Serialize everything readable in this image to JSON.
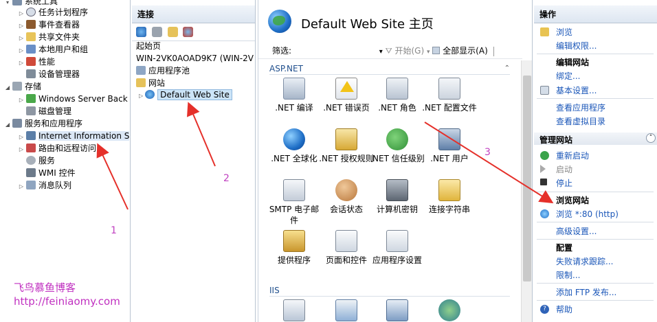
{
  "left_tree": {
    "items": [
      {
        "label": "系统工具",
        "icon": "tools-icon",
        "expand": "▾"
      },
      {
        "label": "任务计划程序",
        "icon": "clock-icon",
        "expand": "▷"
      },
      {
        "label": "事件查看器",
        "icon": "event-log-icon",
        "expand": "▷"
      },
      {
        "label": "共享文件夹",
        "icon": "shared-folder-icon",
        "expand": "▷"
      },
      {
        "label": "本地用户和组",
        "icon": "users-icon",
        "expand": "▷"
      },
      {
        "label": "性能",
        "icon": "performance-icon",
        "expand": "▷"
      },
      {
        "label": "设备管理器",
        "icon": "device-manager-icon",
        "expand": ""
      },
      {
        "label": "存储",
        "icon": "storage-icon",
        "expand": "◢"
      },
      {
        "label": "Windows Server Back",
        "icon": "backup-icon",
        "expand": "▷"
      },
      {
        "label": "磁盘管理",
        "icon": "disk-icon",
        "expand": ""
      },
      {
        "label": "服务和应用程序",
        "icon": "services-apps-icon",
        "expand": "◢"
      },
      {
        "label": "Internet Information S",
        "icon": "iis-icon",
        "expand": "▷"
      },
      {
        "label": "路由和远程访问",
        "icon": "routing-icon",
        "expand": "▷"
      },
      {
        "label": "服务",
        "icon": "gear-icon",
        "expand": ""
      },
      {
        "label": "WMI 控件",
        "icon": "wmi-icon",
        "expand": ""
      },
      {
        "label": "消息队列",
        "icon": "queue-icon",
        "expand": "▷"
      }
    ]
  },
  "connections": {
    "header": "连接",
    "items": [
      {
        "label": "起始页",
        "indent": 0,
        "icon": ""
      },
      {
        "label": "WIN-2VK0AOAD9K7 (WIN-2V",
        "indent": 0,
        "icon": ""
      },
      {
        "label": "应用程序池",
        "indent": 0,
        "icon": "app-pool-icon"
      },
      {
        "label": "网站",
        "indent": 0,
        "icon": "sites-folder-icon"
      },
      {
        "label": "Default Web Site",
        "indent": 1,
        "icon": "website-globe-icon",
        "expand": "▷"
      }
    ]
  },
  "main": {
    "title": "Default Web Site 主页",
    "filter": {
      "label": "筛选:",
      "dropdown": "▾",
      "start": "开始(G)",
      "show_all": "全部显示(A)"
    },
    "groups": [
      {
        "name": "ASP.NET",
        "features": [
          {
            "label": ".NET 编译",
            "icon": "net-compile-icon"
          },
          {
            "label": ".NET 错误页",
            "icon": "net-error-pages-icon"
          },
          {
            "label": ".NET 角色",
            "icon": "net-roles-icon"
          },
          {
            "label": ".NET 配置文件",
            "icon": "net-profile-icon"
          },
          {
            "label": ".NET 全球化",
            "icon": "net-globalization-icon"
          },
          {
            "label": ".NET 授权规则",
            "icon": "net-authorization-icon"
          },
          {
            "label": ".NET 信任级别",
            "icon": "net-trust-levels-icon"
          },
          {
            "label": ".NET 用户",
            "icon": "net-users-icon"
          },
          {
            "label": "SMTP 电子邮件",
            "icon": "smtp-email-icon"
          },
          {
            "label": "会话状态",
            "icon": "session-state-icon"
          },
          {
            "label": "计算机密钥",
            "icon": "machine-key-icon"
          },
          {
            "label": "连接字符串",
            "icon": "connection-strings-icon"
          },
          {
            "label": "提供程序",
            "icon": "providers-icon"
          },
          {
            "label": "页面和控件",
            "icon": "pages-controls-icon"
          },
          {
            "label": "应用程序设置",
            "icon": "app-settings-icon"
          }
        ]
      },
      {
        "name": "IIS",
        "features": [
          {
            "label": "",
            "icon": "asp-icon"
          },
          {
            "label": "",
            "icon": "cgi-icon"
          },
          {
            "label": "",
            "icon": "ip-restrictions-icon"
          },
          {
            "label": "",
            "icon": "http-redirect-icon"
          }
        ]
      }
    ]
  },
  "actions": {
    "header": "操作",
    "browse": "浏览",
    "edit_permissions": "编辑权限...",
    "edit_site": "编辑网站",
    "bindings": "绑定...",
    "basic_settings": "基本设置...",
    "view_apps": "查看应用程序",
    "view_vdirs": "查看虚拟目录",
    "manage_site": "管理网站",
    "restart": "重新启动",
    "start": "启动",
    "stop": "停止",
    "browse_site": "浏览网站",
    "browse_80": "浏览 *:80 (http)",
    "advanced_settings": "高级设置...",
    "configure": "配置",
    "failed_request_tracing": "失败请求跟踪...",
    "limits": "限制...",
    "add_ftp": "添加 FTP 发布...",
    "help": "帮助"
  },
  "annotations": {
    "num1": "1",
    "num2": "2",
    "num3": "3",
    "watermark_name": "飞鸟慕鱼博客",
    "watermark_url": "http://feiniaomy.com"
  },
  "colors": {
    "annotation_red": "#e5302a",
    "annotation_magenta": "#c040c0",
    "link_blue": "#1a56b8"
  }
}
